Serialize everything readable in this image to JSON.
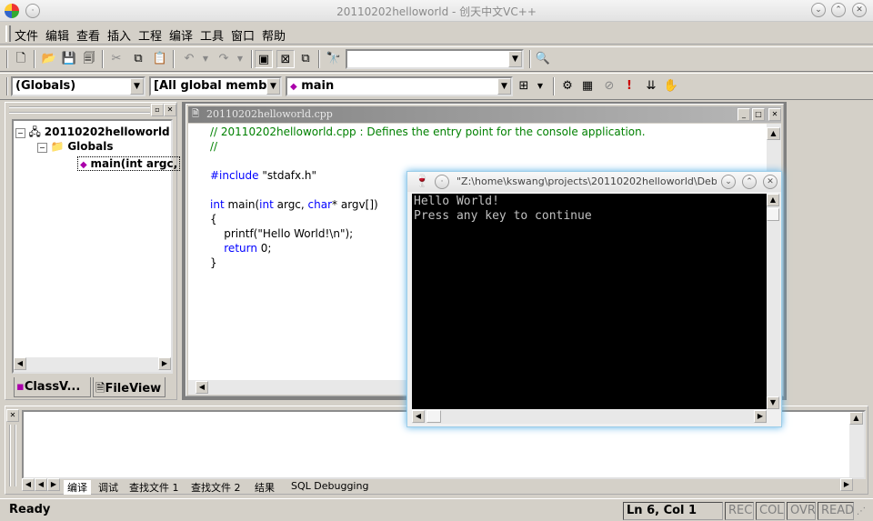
{
  "window": {
    "title": "20110202helloworld - 创天中文VC++"
  },
  "menu": [
    "文件",
    "编辑",
    "查看",
    "插入",
    "工程",
    "编译",
    "工具",
    "窗口",
    "帮助"
  ],
  "wizard_bar": {
    "scope": "(Globals)",
    "filter": "[All global members",
    "member": "main"
  },
  "find_combo": {
    "value": ""
  },
  "class_view": {
    "root": "20110202helloworld",
    "folder": "Globals",
    "item": "main(int argc,",
    "tabs": [
      "ClassV...",
      "FileView"
    ]
  },
  "editor": {
    "title": "20110202helloworld.cpp",
    "lines": [
      {
        "t": "// 20110202helloworld.cpp : Defines the entry point for the console application.",
        "c": "cmt"
      },
      {
        "t": "//",
        "c": "cmt"
      },
      {
        "t": "",
        "c": ""
      },
      {
        "t": "#include \"stdafx.h\"",
        "c": "inc"
      },
      {
        "t": "",
        "c": ""
      },
      {
        "t": "int main(int argc, char* argv[])",
        "c": "sig"
      },
      {
        "t": "{",
        "c": ""
      },
      {
        "t": "    printf(\"Hello World!\\n\");",
        "c": ""
      },
      {
        "t": "    return 0;",
        "c": "ret"
      },
      {
        "t": "}",
        "c": ""
      }
    ]
  },
  "console": {
    "title": "\"Z:\\home\\kswang\\projects\\20110202helloworld\\Deb…",
    "lines": [
      "Hello World!",
      "Press any key to continue"
    ]
  },
  "output_tabs": [
    "编译",
    "调试",
    "查找文件 1",
    "查找文件 2",
    "结果",
    "SQL Debugging"
  ],
  "status": {
    "text": "Ready",
    "pos": "Ln 6, Col 1",
    "indicators": [
      "REC",
      "COL",
      "OVR",
      "READ"
    ]
  }
}
